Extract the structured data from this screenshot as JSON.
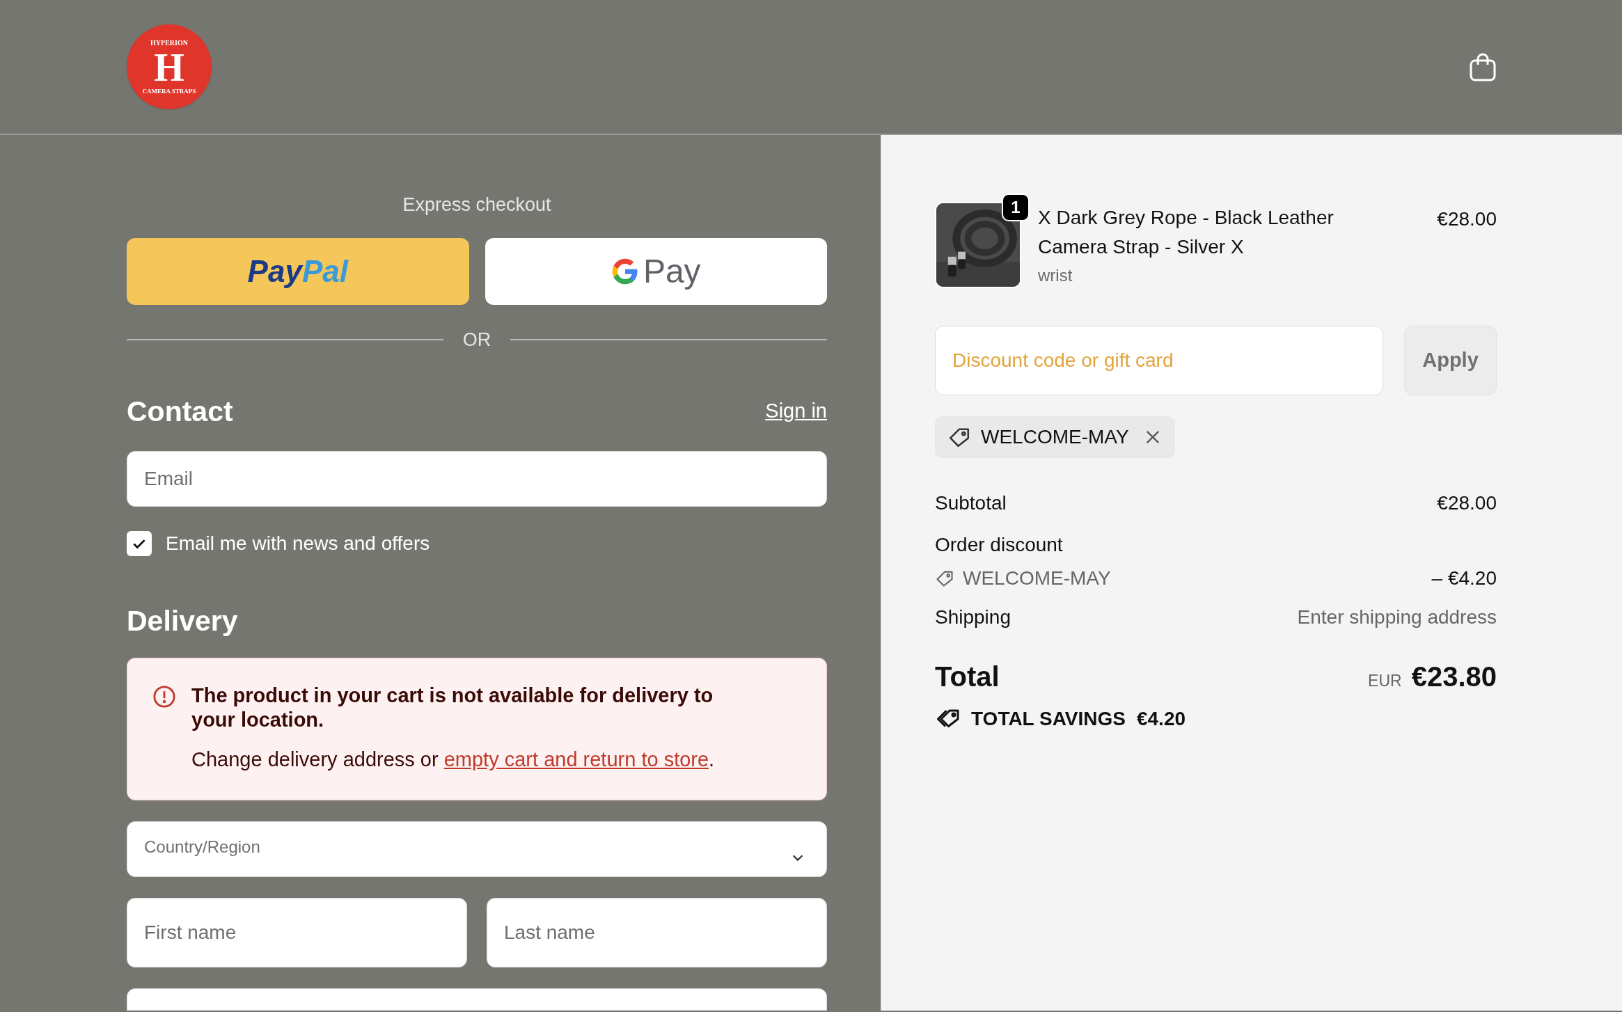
{
  "header": {
    "logo": {
      "top": "HYPERION",
      "mark": "H",
      "bottom": "CAMERA STRAPS"
    }
  },
  "express_checkout": {
    "title": "Express checkout",
    "paypal_label": [
      "Pay",
      "Pal"
    ],
    "gpay_label": "Pay",
    "divider": "OR"
  },
  "contact": {
    "heading": "Contact",
    "sign_in": "Sign in",
    "email": {
      "placeholder": "Email"
    },
    "newsletter": {
      "label": "Email me with news and offers",
      "checked": true
    }
  },
  "delivery": {
    "heading": "Delivery",
    "alert": {
      "title": "The product in your cart is not available for delivery to your location.",
      "text": "Change delivery address or ",
      "link": "empty cart and return to store",
      "after": "."
    },
    "country": {
      "label": "Country/Region"
    },
    "first_name": {
      "placeholder": "First name"
    },
    "last_name": {
      "placeholder": "Last name"
    }
  },
  "summary": {
    "items": [
      {
        "quantity": "1",
        "title": "X Dark Grey Rope - Black Leather Camera Strap - Silver X",
        "variant": "wrist",
        "price": "€28.00"
      }
    ],
    "discount": {
      "placeholder": "Discount code or gift card",
      "button": "Apply"
    },
    "applied_codes": [
      "WELCOME-MAY"
    ],
    "subtotal": {
      "label": "Subtotal",
      "value": "€28.00"
    },
    "order_discount": {
      "label": "Order discount",
      "code": "WELCOME-MAY",
      "value": "– €4.20"
    },
    "shipping": {
      "label": "Shipping",
      "value": "Enter shipping address"
    },
    "total": {
      "label": "Total",
      "currency": "EUR",
      "value": "€23.80"
    },
    "savings": {
      "label": "TOTAL SAVINGS",
      "value": "€4.20"
    }
  }
}
